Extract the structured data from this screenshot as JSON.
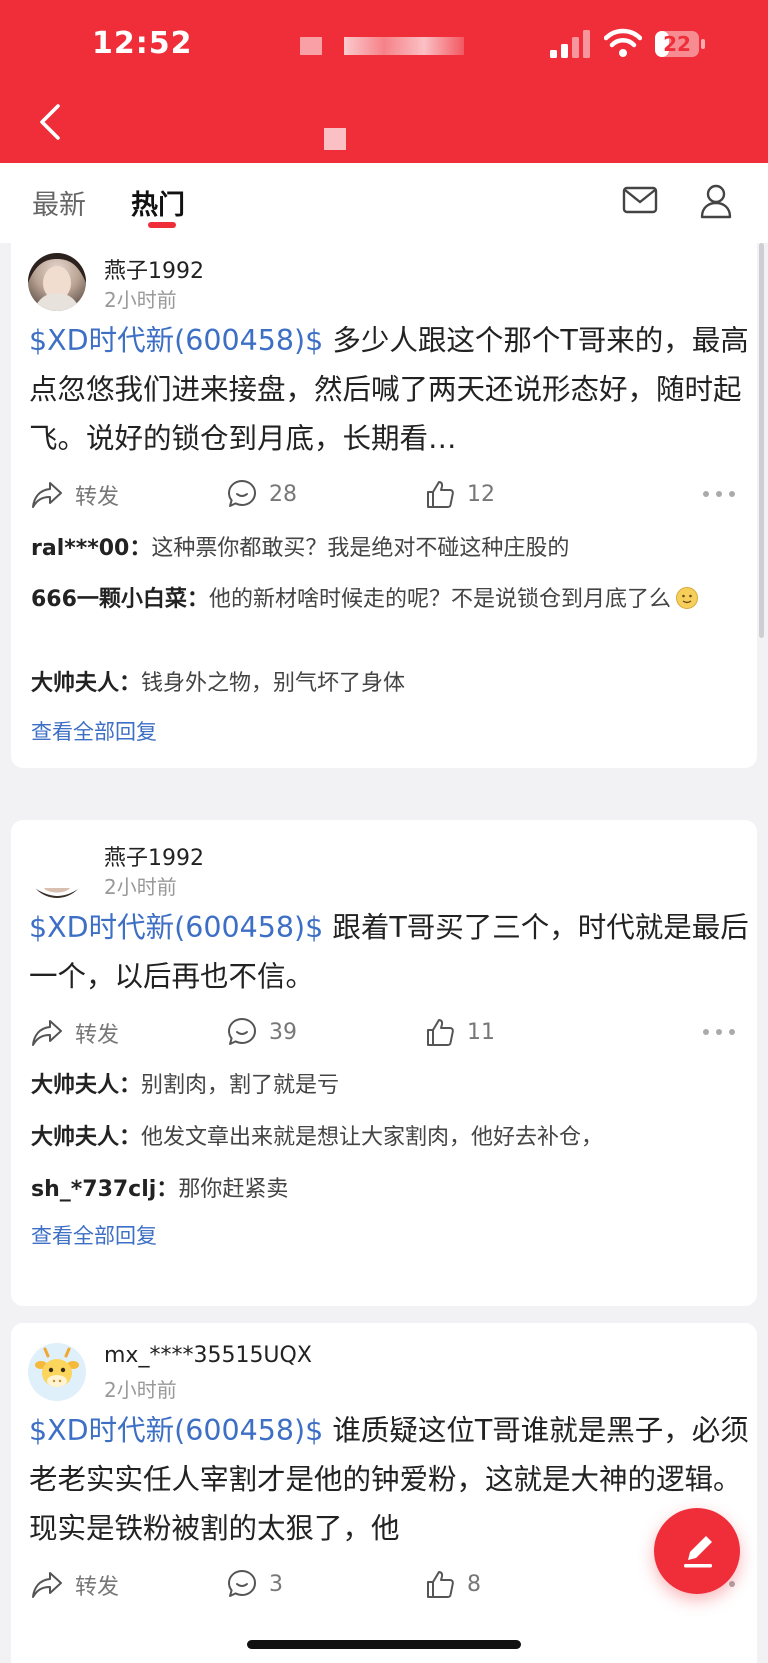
{
  "status_bar": {
    "time": "12:52",
    "battery": "22"
  },
  "tabs": [
    {
      "label": "最新"
    },
    {
      "label": "热门"
    }
  ],
  "posts": [
    {
      "author": "燕子1992",
      "time_ago": "2小时前",
      "tag": "$XD时代新(600458)$",
      "text": "多少人跟这个那个T哥来的，最高点忽悠我们进来接盘，然后喊了两天还说形态好，随时起飞。说好的锁仓到月底，长期看…",
      "forward_label": "转发",
      "comment_count": "28",
      "like_count": "12",
      "replies": [
        {
          "user": "ral***00：",
          "text": "这种票你都敢买？我是绝对不碰这种庄股的"
        },
        {
          "user": "666一颗小白菜：",
          "text": "他的新材啥时候走的呢？不是说锁仓到月底了么"
        },
        {
          "user": "大帅夫人：",
          "text": "钱身外之物，别气坏了身体"
        }
      ],
      "view_all": "查看全部回复"
    },
    {
      "author": "燕子1992",
      "time_ago": "2小时前",
      "tag": "$XD时代新(600458)$",
      "text": "跟着T哥买了三个，时代就是最后一个，以后再也不信。",
      "forward_label": "转发",
      "comment_count": "39",
      "like_count": "11",
      "replies": [
        {
          "user": "大帅夫人：",
          "text": "别割肉，割了就是亏"
        },
        {
          "user": "大帅夫人：",
          "text": "他发文章出来就是想让大家割肉，他好去补仓，"
        },
        {
          "user": "sh_*737clj：",
          "text": "那你赶紧卖"
        }
      ],
      "view_all": "查看全部回复"
    },
    {
      "author": "mx_****35515UQX",
      "time_ago": "2小时前",
      "tag": "$XD时代新(600458)$",
      "text": "谁质疑这位T哥谁就是黑子，必须老老实实任人宰割才是他的钟爱粉，这就是大神的逻辑。现实是铁粉被割的太狠了，他",
      "forward_label": "转发",
      "comment_count": "3",
      "like_count": "8"
    }
  ],
  "colors": {
    "brand_red": "#ef2e3a",
    "link_blue": "#3d6fc5"
  },
  "icons": [
    "back-arrow-icon",
    "mail-icon",
    "user-icon",
    "share-icon",
    "comment-icon",
    "like-icon",
    "more-icon",
    "edit-icon"
  ]
}
